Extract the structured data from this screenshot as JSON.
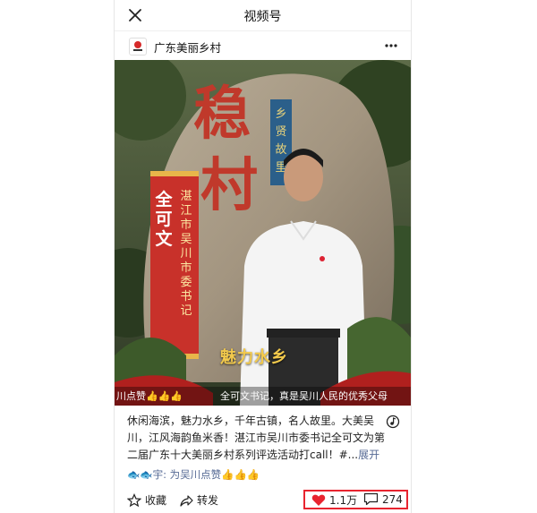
{
  "header": {
    "title": "视频号",
    "close_icon": "close-icon"
  },
  "account": {
    "name": "广东美丽乡村",
    "more_icon": "more-icon"
  },
  "video": {
    "rock_text": "稳村",
    "side_plaque": "乡贤故里",
    "red_banner_name": "全可文",
    "red_banner_title": "湛江市吴川市委书记",
    "slogan": "魅力水乡",
    "ticker_left": "川点赞👍👍👍",
    "ticker_right": "全可文书记，真是吴川人民的优秀父母"
  },
  "description": {
    "text": "休闲海滨，魅力水乡，千年古镇，名人故里。大美吴川，江风海韵鱼米香！湛江市吴川市委书记全可文为第二届广东十大美丽乡村系列评选活动打call！#...",
    "expand_label": "展开"
  },
  "likes_line": {
    "prefix": "🐟🐟宇: 为吴川点赞",
    "emoji": "👍👍👍"
  },
  "actions": {
    "favorite_label": "收藏",
    "share_label": "转发",
    "like_count": "1.1万",
    "comment_count": "274"
  },
  "colors": {
    "accent_red": "#e8242f",
    "link_blue": "#576b95"
  }
}
